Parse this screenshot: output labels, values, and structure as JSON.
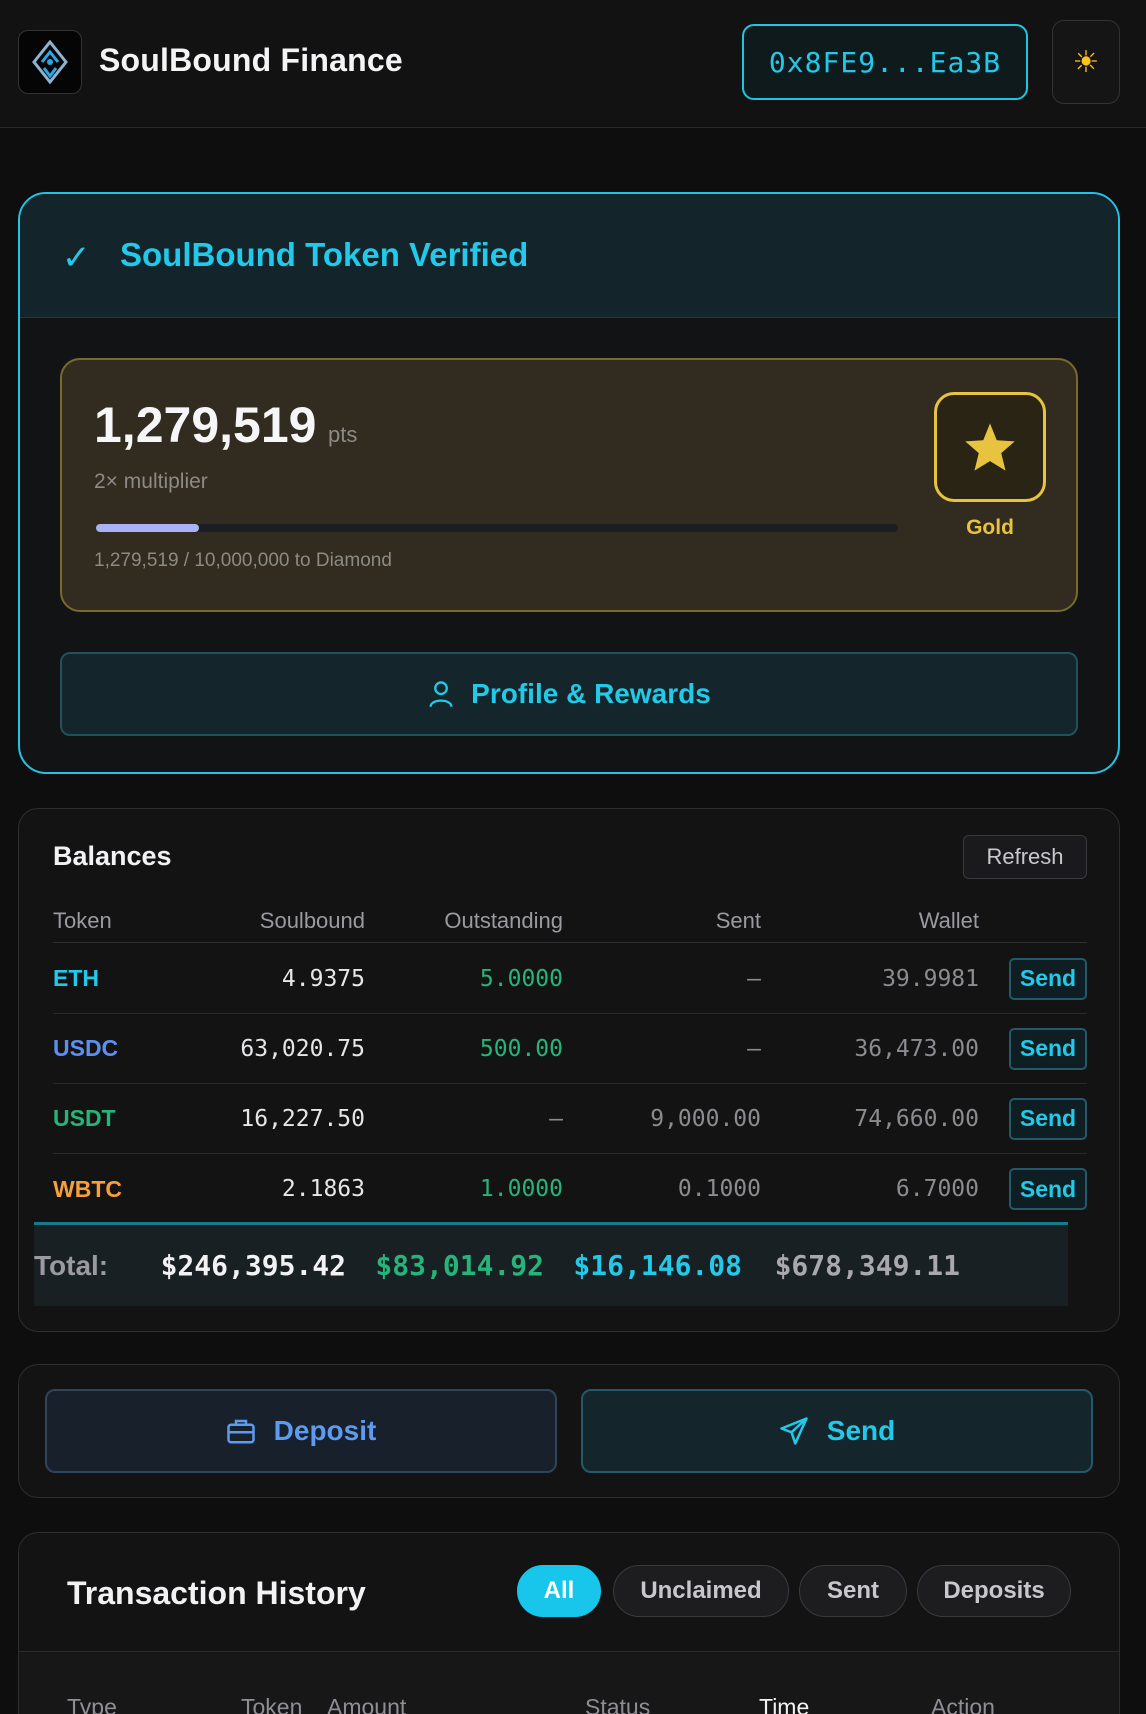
{
  "header": {
    "brand": "SoulBound Finance",
    "wallet_address": "0x8FE9...Ea3B",
    "theme_icon": "sun-icon"
  },
  "verified": {
    "title": "SoulBound Token Verified",
    "points": "1,279,519",
    "points_unit": "pts",
    "multiplier": "2× multiplier",
    "progress_text": "1,279,519 / 10,000,000 to Diamond",
    "progress_fraction": 0.128,
    "tier": "Gold",
    "profile_button": "Profile & Rewards"
  },
  "balances": {
    "title": "Balances",
    "refresh_label": "Refresh",
    "columns": [
      "Token",
      "Soulbound",
      "Outstanding",
      "Sent",
      "Wallet"
    ],
    "rows": [
      {
        "token": "ETH",
        "color": "#22c9e8",
        "soulbound": "4.9375",
        "outstanding": "5.0000",
        "sent": "—",
        "wallet": "39.9981",
        "action": "Send"
      },
      {
        "token": "USDC",
        "color": "#5c8ff0",
        "soulbound": "63,020.75",
        "outstanding": "500.00",
        "sent": "—",
        "wallet": "36,473.00",
        "action": "Send"
      },
      {
        "token": "USDT",
        "color": "#25b57a",
        "soulbound": "16,227.50",
        "outstanding": "—",
        "sent": "9,000.00",
        "wallet": "74,660.00",
        "action": "Send"
      },
      {
        "token": "WBTC",
        "color": "#f5a03a",
        "soulbound": "2.1863",
        "outstanding": "1.0000",
        "sent": "0.1000",
        "wallet": "6.7000",
        "action": "Send"
      }
    ],
    "total": {
      "label": "Total:",
      "soulbound": "$246,395.42",
      "outstanding": "$83,014.92",
      "sent": "$16,146.08",
      "wallet": "$678,349.11"
    }
  },
  "actions": {
    "deposit_label": "Deposit",
    "send_label": "Send"
  },
  "history": {
    "title": "Transaction History",
    "filters": [
      "All",
      "Unclaimed",
      "Sent",
      "Deposits"
    ],
    "active_filter": "All",
    "columns": [
      "Type",
      "Token",
      "Amount",
      "Status",
      "Time",
      "Action"
    ]
  }
}
